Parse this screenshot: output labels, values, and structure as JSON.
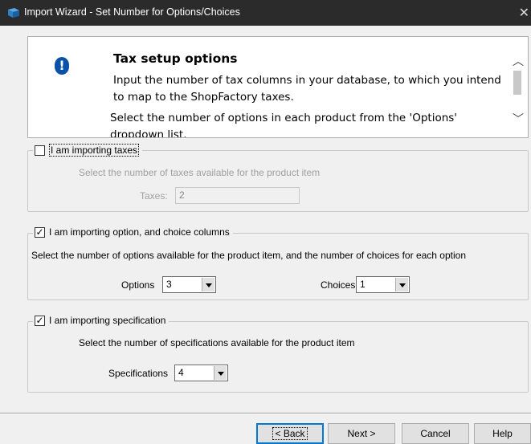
{
  "window": {
    "title": "Import Wizard - Set Number for Options/Choices",
    "close_glyph": "✕"
  },
  "info": {
    "heading": "Tax setup options",
    "text1": "Input the number of tax columns in your database, to which you intend to map to the ShopFactory taxes.",
    "text2": "Select the number of options in each product from the 'Options' dropdown list."
  },
  "taxes_group": {
    "checkbox_label": "I am importing taxes",
    "checked": false,
    "description": "Select the number of taxes available for the product item",
    "field_label": "Taxes:",
    "field_value": "2"
  },
  "options_group": {
    "checkbox_label": "I am importing option, and choice columns",
    "checked": true,
    "description": "Select the number of options available for the product item, and the number of choices for each option",
    "options_label": "Options",
    "options_value": "3",
    "choices_label": "Choices",
    "choices_value": "1"
  },
  "spec_group": {
    "checkbox_label": "I am importing specification",
    "checked": true,
    "description": "Select the number of specifications available for the product item",
    "spec_label": "Specifications",
    "spec_value": "4"
  },
  "buttons": {
    "back": "< Back",
    "next": "Next >",
    "cancel": "Cancel",
    "help": "Help"
  },
  "colors": {
    "titlebar": "#2b2b2b",
    "info_icon": "#0a52a9",
    "focus_border": "#0078d7"
  }
}
